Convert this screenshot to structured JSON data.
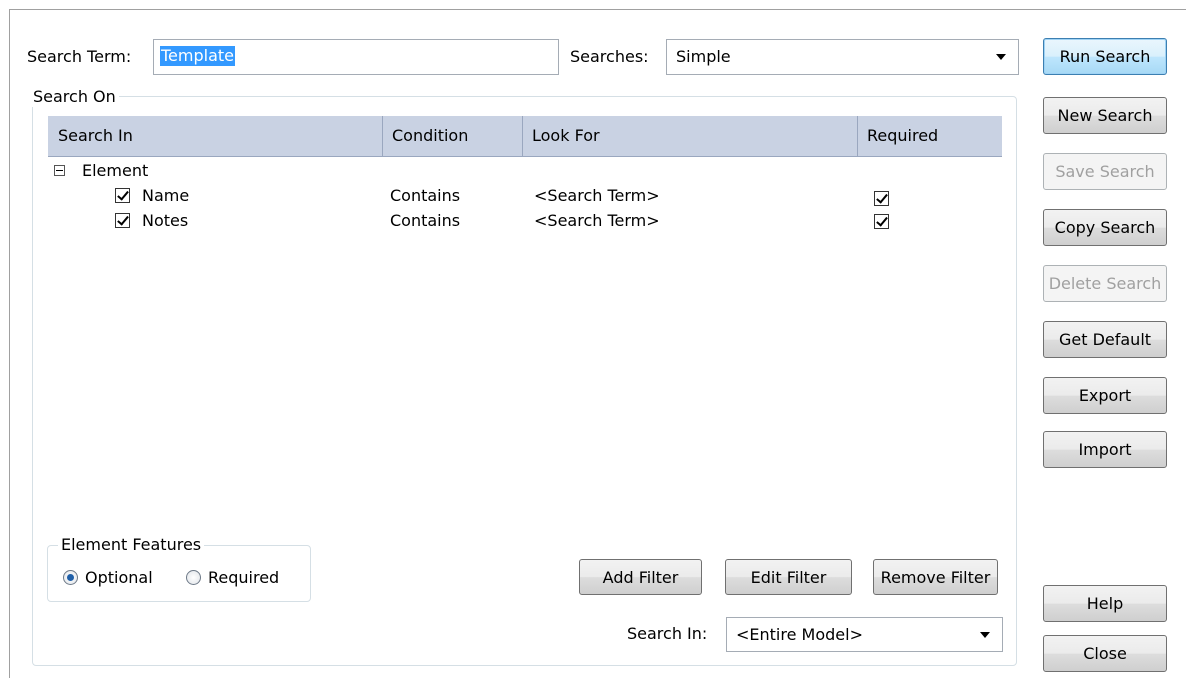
{
  "search_term": {
    "label": "Search Term:",
    "value": "Template"
  },
  "searches": {
    "label": "Searches:",
    "value": "Simple"
  },
  "search_on": {
    "title": "Search On"
  },
  "grid": {
    "columns": [
      "Search In",
      "Condition",
      "Look For",
      "Required"
    ],
    "tree_root": "Element",
    "rows": [
      {
        "name": "Name",
        "condition": "Contains",
        "look_for": "<Search Term>"
      },
      {
        "name": "Notes",
        "condition": "Contains",
        "look_for": "<Search Term>"
      }
    ]
  },
  "element_features": {
    "title": "Element Features",
    "optional_label": "Optional",
    "required_label": "Required",
    "selected": "Optional"
  },
  "filter_buttons": {
    "add": "Add Filter",
    "edit": "Edit Filter",
    "remove": "Remove Filter"
  },
  "search_in": {
    "label": "Search In:",
    "value": "<Entire Model>"
  },
  "side_buttons": {
    "run": "Run Search",
    "new": "New Search",
    "save": "Save Search",
    "copy": "Copy Search",
    "delete": "Delete Search",
    "get_default": "Get Default",
    "export": "Export",
    "import": "Import",
    "help": "Help",
    "close": "Close"
  }
}
